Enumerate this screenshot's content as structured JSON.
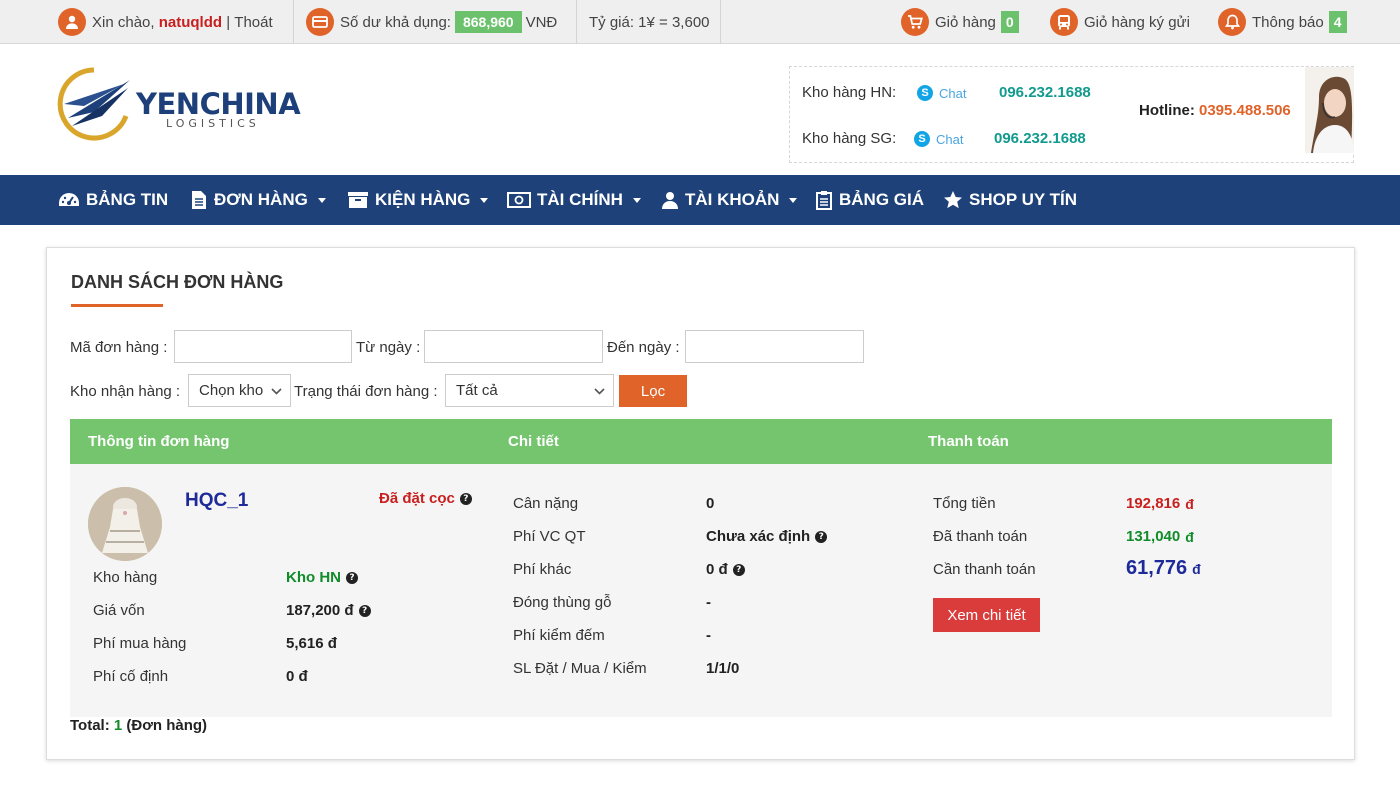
{
  "topbar": {
    "greeting": "Xin chào,",
    "username": "natuqldd",
    "divider": "|",
    "logout": "Thoát",
    "balance_label": "Số dư khả dụng:",
    "balance_value": "868,960",
    "balance_unit": "VNĐ",
    "exchange_rate": "Tỷ giá: 1¥ = 3,600",
    "cart_label": "Giỏ hàng",
    "cart_count": "0",
    "consign_cart_label": "Giỏ hàng ký gửi",
    "notify_label": "Thông báo",
    "notify_count": "4"
  },
  "header": {
    "logo_text": "YENCHINA",
    "logo_sub": "LOGISTICS",
    "contacts": [
      {
        "label": "Kho hàng HN:",
        "chat": "Chat",
        "phone": "096.232.1688"
      },
      {
        "label": "Kho hàng SG:",
        "chat": "Chat",
        "phone": "096.232.1688"
      }
    ],
    "hotline_label": "Hotline:",
    "hotline_number": "0395.488.506"
  },
  "nav": {
    "items": [
      {
        "label": "BẢNG TIN",
        "icon": "dashboard-icon",
        "dropdown": false
      },
      {
        "label": "ĐƠN HÀNG",
        "icon": "document-icon",
        "dropdown": true
      },
      {
        "label": "KIỆN HÀNG",
        "icon": "package-icon",
        "dropdown": true
      },
      {
        "label": "TÀI CHÍNH",
        "icon": "money-icon",
        "dropdown": true
      },
      {
        "label": "TÀI KHOẢN",
        "icon": "user-icon",
        "dropdown": true
      },
      {
        "label": "BẢNG GIÁ",
        "icon": "clipboard-icon",
        "dropdown": false
      },
      {
        "label": "SHOP UY TÍN",
        "icon": "star-icon",
        "dropdown": false
      }
    ]
  },
  "filters": {
    "title": "DANH SÁCH ĐƠN HÀNG",
    "order_code_label": "Mã đơn hàng :",
    "order_code_value": "",
    "from_date_label": "Từ ngày :",
    "from_date_value": "",
    "to_date_label": "Đến ngày :",
    "to_date_value": "",
    "warehouse_label": "Kho nhận hàng :",
    "warehouse_selected": "Chọn kho",
    "status_label": "Trạng thái đơn hàng :",
    "status_selected": "Tất cả",
    "filter_button": "Lọc"
  },
  "table": {
    "headers": [
      "Thông tin đơn hàng",
      "Chi tiết",
      "Thanh toán"
    ],
    "order": {
      "code": "HQC_1",
      "status": "Đã đặt cọc",
      "info": [
        {
          "label": "Kho hàng",
          "value": "Kho HN"
        },
        {
          "label": "Giá vốn",
          "value": "187,200 đ"
        },
        {
          "label": "Phí mua hàng",
          "value": "5,616 đ"
        },
        {
          "label": "Phí cố định",
          "value": "0 đ"
        }
      ],
      "details": [
        {
          "label": "Cân nặng",
          "value": "0"
        },
        {
          "label": "Phí VC QT",
          "value": "Chưa xác định"
        },
        {
          "label": "Phí khác",
          "value": "0 đ"
        },
        {
          "label": "Đóng thùng gỗ",
          "value": "-"
        },
        {
          "label": "Phí kiểm đếm",
          "value": "-"
        },
        {
          "label": "SL Đặt / Mua / Kiểm",
          "value": "1/1/0"
        }
      ],
      "payment": {
        "total_label": "Tổng tiền",
        "total_value": "192,816",
        "paid_label": "Đã thanh toán",
        "paid_value": "131,040",
        "due_label": "Cần thanh toán",
        "due_value": "61,776",
        "currency": "đ",
        "detail_button": "Xem chi tiết"
      }
    }
  },
  "summary": {
    "total_label": "Total:",
    "total_count": "1",
    "total_unit": "(Đơn hàng)"
  },
  "colors": {
    "accent_orange": "#e0632a",
    "nav_blue": "#1d4178",
    "table_green": "#75c56f",
    "button_red": "#da3b3b"
  }
}
